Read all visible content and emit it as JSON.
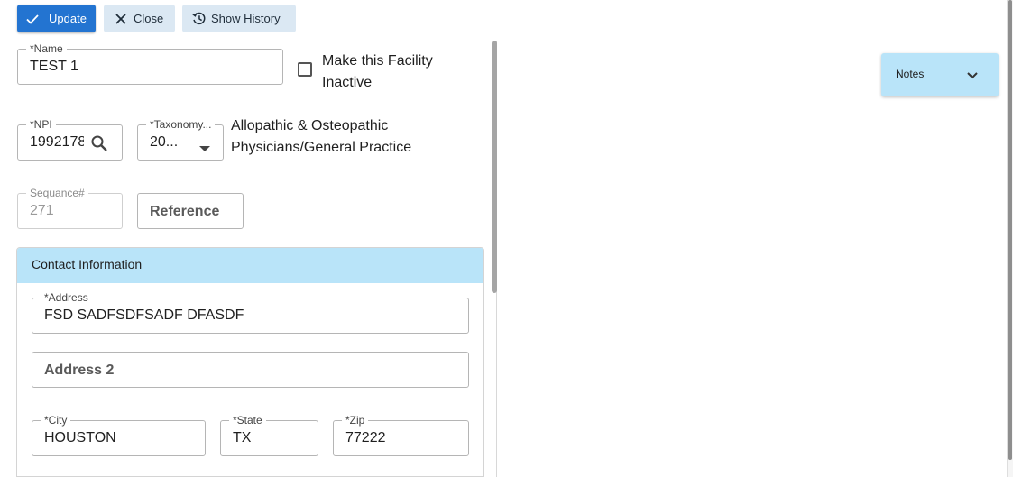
{
  "toolbar": {
    "update_label": "Update",
    "close_label": "Close",
    "history_label": "Show History"
  },
  "form": {
    "name": {
      "label": "*Name",
      "value": "TEST 1"
    },
    "inactive": {
      "label_line1": "Make this Facility",
      "label_line2": "Inactive",
      "checked": false
    },
    "npi": {
      "label": "*NPI",
      "value": "1992178"
    },
    "taxonomy": {
      "label": "*Taxonomy...",
      "value": "20...",
      "description_line1": "Allopathic & Osteopathic",
      "description_line2": "Physicians/General Practice"
    },
    "sequence": {
      "label": "Sequance#",
      "value": "271"
    },
    "reference": {
      "placeholder": "Reference"
    }
  },
  "contact": {
    "title": "Contact Information",
    "address": {
      "label": "*Address",
      "value": "FSD SADFSDFSADF DFASDF"
    },
    "address2": {
      "placeholder": "Address 2"
    },
    "city": {
      "label": "*City",
      "value": "HOUSTON"
    },
    "state": {
      "label": "*State",
      "value": "TX"
    },
    "zip": {
      "label": "*Zip",
      "value": "77222"
    }
  },
  "notes": {
    "label": "Notes"
  },
  "icons": {
    "update": "check-icon",
    "close": "close-icon",
    "history": "history-icon",
    "npi_search": "search-icon",
    "taxonomy_dropdown": "caret-down-icon",
    "notes_expand": "chevron-down-icon"
  },
  "colors": {
    "primary": "#2374d1",
    "secondary_button": "#dbe8f3",
    "panel_header": "#b9e4f9"
  }
}
